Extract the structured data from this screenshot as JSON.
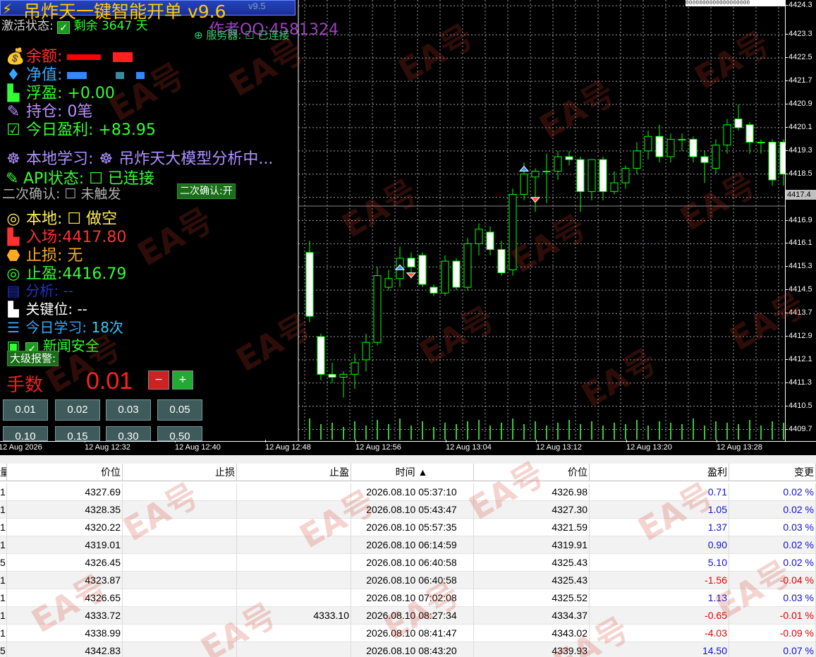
{
  "panel": {
    "title": "吊炸天一键智能开单 v9.6",
    "title_small": "v9.5",
    "activation_label": "激活状态:",
    "remaining": "剩余 3647 天",
    "author": "作者QQ:4581324",
    "server": "服务器: ☐ 已连接",
    "balance_label": "余额:",
    "equity_label": "净值:",
    "floating": "浮盈: +0.00",
    "positions": "持仓: 0笔",
    "today_profit": "今日盈利: +83.95",
    "local_learning": "本地学习:",
    "model_status": "吊炸天大模型分析中...",
    "api_status": "API状态: ☐ 已连接",
    "secondary_confirm": "二次确认: ☐ 未触发",
    "secondary_confirm_btn": "二次确认:开",
    "local": "本地: ☐ 做空",
    "entry": "入场:4417.80",
    "stoploss": "止损: 无",
    "takeprofit": "止盈:4416.79",
    "analysis": "分析: --",
    "key_level": "关键位: --",
    "today_learning_label": "今日学习:",
    "today_learning_value": "18次",
    "news_label": "新闻安全",
    "alert_btn": "大级报警:",
    "lots_label": "手数",
    "lots_value": "0.01",
    "minus": "−",
    "plus": "+",
    "lot_buttons_row1": [
      "0.01",
      "0.02",
      "0.03",
      "0.05"
    ],
    "lot_buttons_row2": [
      "0.10",
      "0.15",
      "0.30",
      "0.50"
    ]
  },
  "chart": {
    "top_strip": "0000000000000000000",
    "current_price": "4417.4",
    "price_labels": [
      "4424.3",
      "4423.3",
      "4422.5",
      "4421.7",
      "4420.9",
      "4420.1",
      "4419.3",
      "4418.5",
      "4417.7",
      "4416.9",
      "4416.1",
      "4415.3",
      "4414.5",
      "4413.7",
      "4412.9",
      "4412.1",
      "4411.3",
      "4410.5",
      "4409.7"
    ],
    "time_labels": [
      "12 Aug 2026",
      "12 Aug 12:32",
      "12 Aug 12:40",
      "12 Aug 12:48",
      "12 Aug 12:56",
      "12 Aug 13:04",
      "12 Aug 13:12",
      "12 Aug 13:20",
      "12 Aug 13:28"
    ],
    "colors": {
      "bull": "#00ff00",
      "bear_body": "#ffffff",
      "grid": "#9aa0a6",
      "volume": "#33cc33"
    }
  },
  "chart_data": {
    "type": "candlestick",
    "ylim": [
      4409.3,
      4424.5
    ],
    "candles": [
      {
        "o": 4415.8,
        "h": 4416.2,
        "l": 4413.4,
        "c": 4413.6
      },
      {
        "o": 4412.9,
        "h": 4413.0,
        "l": 4411.4,
        "c": 4411.6
      },
      {
        "o": 4411.6,
        "h": 4412.0,
        "l": 4411.3,
        "c": 4411.5
      },
      {
        "o": 4411.5,
        "h": 4411.7,
        "l": 4410.8,
        "c": 4411.6
      },
      {
        "o": 4411.6,
        "h": 4412.3,
        "l": 4411.1,
        "c": 4412.0
      },
      {
        "o": 4412.1,
        "h": 4413.0,
        "l": 4411.7,
        "c": 4412.7
      },
      {
        "o": 4412.7,
        "h": 4415.3,
        "l": 4412.6,
        "c": 4415.0
      },
      {
        "o": 4414.6,
        "h": 4415.2,
        "l": 4414.5,
        "c": 4414.9
      },
      {
        "o": 4414.9,
        "h": 4416.0,
        "l": 4414.6,
        "c": 4415.6
      },
      {
        "o": 4415.6,
        "h": 4415.8,
        "l": 4414.9,
        "c": 4415.3
      },
      {
        "o": 4415.7,
        "h": 4415.8,
        "l": 4414.6,
        "c": 4414.7
      },
      {
        "o": 4414.6,
        "h": 4414.7,
        "l": 4414.3,
        "c": 4414.4
      },
      {
        "o": 4414.4,
        "h": 4415.7,
        "l": 4414.3,
        "c": 4415.5
      },
      {
        "o": 4415.5,
        "h": 4415.6,
        "l": 4414.5,
        "c": 4414.6
      },
      {
        "o": 4414.6,
        "h": 4416.3,
        "l": 4414.5,
        "c": 4416.1
      },
      {
        "o": 4416.1,
        "h": 4416.8,
        "l": 4415.7,
        "c": 4416.6
      },
      {
        "o": 4416.5,
        "h": 4416.7,
        "l": 4415.7,
        "c": 4415.9
      },
      {
        "o": 4415.9,
        "h": 4416.2,
        "l": 4415.0,
        "c": 4415.1
      },
      {
        "o": 4415.2,
        "h": 4418.0,
        "l": 4415.0,
        "c": 4417.8
      },
      {
        "o": 4417.8,
        "h": 4418.9,
        "l": 4417.6,
        "c": 4418.5
      },
      {
        "o": 4418.4,
        "h": 4418.7,
        "l": 4417.2,
        "c": 4418.6
      },
      {
        "o": 4418.6,
        "h": 4419.2,
        "l": 4417.5,
        "c": 4418.6
      },
      {
        "o": 4418.6,
        "h": 4419.3,
        "l": 4418.3,
        "c": 4419.1
      },
      {
        "o": 4419.1,
        "h": 4419.3,
        "l": 4418.8,
        "c": 4419.0
      },
      {
        "o": 4419.0,
        "h": 4419.1,
        "l": 4417.2,
        "c": 4417.9
      },
      {
        "o": 4417.9,
        "h": 4419.0,
        "l": 4417.6,
        "c": 4419.0
      },
      {
        "o": 4419.0,
        "h": 4419.1,
        "l": 4417.6,
        "c": 4417.9
      },
      {
        "o": 4417.9,
        "h": 4418.6,
        "l": 4417.8,
        "c": 4418.2
      },
      {
        "o": 4418.2,
        "h": 4418.8,
        "l": 4418.0,
        "c": 4418.7
      },
      {
        "o": 4418.7,
        "h": 4419.6,
        "l": 4418.5,
        "c": 4419.3
      },
      {
        "o": 4419.3,
        "h": 4420.0,
        "l": 4419.0,
        "c": 4419.8
      },
      {
        "o": 4419.8,
        "h": 4420.2,
        "l": 4418.9,
        "c": 4419.1
      },
      {
        "o": 4419.1,
        "h": 4419.9,
        "l": 4418.9,
        "c": 4419.7
      },
      {
        "o": 4419.7,
        "h": 4419.9,
        "l": 4419.3,
        "c": 4419.7
      },
      {
        "o": 4419.7,
        "h": 4419.8,
        "l": 4418.9,
        "c": 4419.1
      },
      {
        "o": 4419.1,
        "h": 4419.3,
        "l": 4418.2,
        "c": 4418.9
      },
      {
        "o": 4418.7,
        "h": 4419.7,
        "l": 4418.5,
        "c": 4419.5
      },
      {
        "o": 4419.5,
        "h": 4420.4,
        "l": 4419.2,
        "c": 4420.2
      },
      {
        "o": 4420.4,
        "h": 4420.9,
        "l": 4420.0,
        "c": 4420.1
      },
      {
        "o": 4420.2,
        "h": 4420.3,
        "l": 4419.2,
        "c": 4419.6
      },
      {
        "o": 4419.6,
        "h": 4419.7,
        "l": 4419.2,
        "c": 4419.6
      },
      {
        "o": 4419.6,
        "h": 4419.7,
        "l": 4418.1,
        "c": 4418.3
      },
      {
        "o": 4419.6,
        "h": 4419.7,
        "l": 4418.1,
        "c": 4418.5
      },
      {
        "o": 4417.9,
        "h": 4418.3,
        "l": 4417.0,
        "c": 4417.2
      }
    ],
    "signals": [
      {
        "bar": 8,
        "type": "buy",
        "price": 4415.3
      },
      {
        "bar": 9,
        "type": "sell",
        "price": 4415.0
      },
      {
        "bar": 19,
        "type": "buy",
        "price": 4418.7
      },
      {
        "bar": 20,
        "type": "sell",
        "price": 4417.6
      }
    ],
    "volumes": [
      30,
      22,
      24,
      18,
      26,
      20,
      28,
      22,
      30,
      20,
      26,
      18,
      24,
      22,
      26,
      28,
      20,
      24,
      30,
      22,
      26,
      20,
      24,
      28,
      22,
      26,
      20,
      24,
      22,
      28,
      20,
      26,
      24,
      22,
      30,
      20,
      26,
      24,
      22,
      28,
      20,
      26,
      24,
      18
    ]
  },
  "table": {
    "headers": [
      "量",
      "价位",
      "止损",
      "止盈",
      "时间",
      "价位",
      "盈利",
      "变更"
    ],
    "rows": [
      {
        "vol": "1",
        "open": "4327.69",
        "sl": "",
        "tp": "",
        "time": "2026.08.10 05:37:10",
        "close": "4326.98",
        "profit": "0.71",
        "change": "0.02 %",
        "neg": false
      },
      {
        "vol": "1",
        "open": "4328.35",
        "sl": "",
        "tp": "",
        "time": "2026.08.10 05:43:47",
        "close": "4327.30",
        "profit": "1.05",
        "change": "0.02 %",
        "neg": false
      },
      {
        "vol": "1",
        "open": "4320.22",
        "sl": "",
        "tp": "",
        "time": "2026.08.10 05:57:35",
        "close": "4321.59",
        "profit": "1.37",
        "change": "0.03 %",
        "neg": false
      },
      {
        "vol": "1",
        "open": "4319.01",
        "sl": "",
        "tp": "",
        "time": "2026.08.10 06:14:59",
        "close": "4319.91",
        "profit": "0.90",
        "change": "0.02 %",
        "neg": false
      },
      {
        "vol": "5",
        "open": "4326.45",
        "sl": "",
        "tp": "",
        "time": "2026.08.10 06:40:58",
        "close": "4325.43",
        "profit": "5.10",
        "change": "0.02 %",
        "neg": false
      },
      {
        "vol": "1",
        "open": "4323.87",
        "sl": "",
        "tp": "",
        "time": "2026.08.10 06:40:58",
        "close": "4325.43",
        "profit": "-1.56",
        "change": "-0.04 %",
        "neg": true
      },
      {
        "vol": "1",
        "open": "4326.65",
        "sl": "",
        "tp": "",
        "time": "2026.08.10 07:02:08",
        "close": "4325.52",
        "profit": "1.13",
        "change": "0.03 %",
        "neg": false
      },
      {
        "vol": "1",
        "open": "4333.72",
        "sl": "",
        "tp": "4333.10",
        "time": "2026.08.10 08:27:34",
        "close": "4334.37",
        "profit": "-0.65",
        "change": "-0.01 %",
        "neg": true
      },
      {
        "vol": "1",
        "open": "4338.99",
        "sl": "",
        "tp": "",
        "time": "2026.08.10 08:41:47",
        "close": "4343.02",
        "profit": "-4.03",
        "change": "-0.09 %",
        "neg": true
      },
      {
        "vol": "5",
        "open": "4342.83",
        "sl": "",
        "tp": "",
        "time": "2026.08.10 08:43:20",
        "close": "4339.93",
        "profit": "14.50",
        "change": "0.07 %",
        "neg": false
      }
    ]
  },
  "watermark": "EA号"
}
